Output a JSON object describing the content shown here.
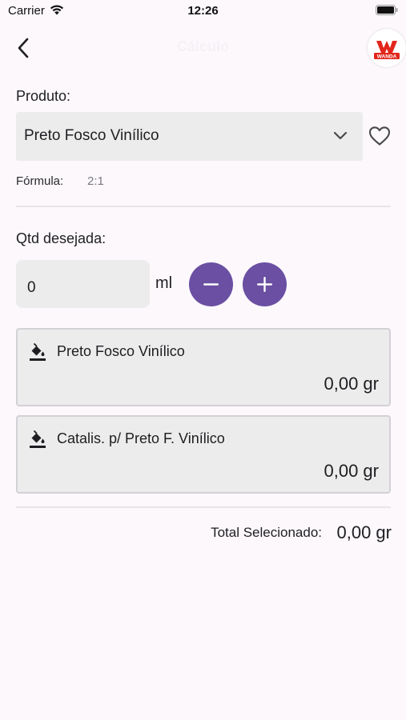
{
  "status_bar": {
    "carrier": "Carrier",
    "time": "12:26"
  },
  "nav": {
    "title": "Cálculo",
    "logo_text": "WANDA",
    "brand_color": "#e2261c"
  },
  "product": {
    "label": "Produto:",
    "selected": "Preto Fosco Vinílico"
  },
  "formula": {
    "label": "Fórmula:",
    "value": "2:1"
  },
  "quantity": {
    "label": "Qtd desejada:",
    "value": "0",
    "unit": "ml"
  },
  "components": [
    {
      "name": "Preto Fosco Vinílico",
      "weight": "0,00 gr",
      "icon": "paint-bucket-icon"
    },
    {
      "name": "Catalis. p/ Preto F. Vinílico",
      "weight": "0,00 gr",
      "icon": "paint-bucket-icon"
    }
  ],
  "total": {
    "label": "Total Selecionado:",
    "value": "0,00 gr"
  },
  "colors": {
    "accent": "#6a4fa2",
    "field_bg": "#ececec",
    "background": "#fcf8fc"
  }
}
